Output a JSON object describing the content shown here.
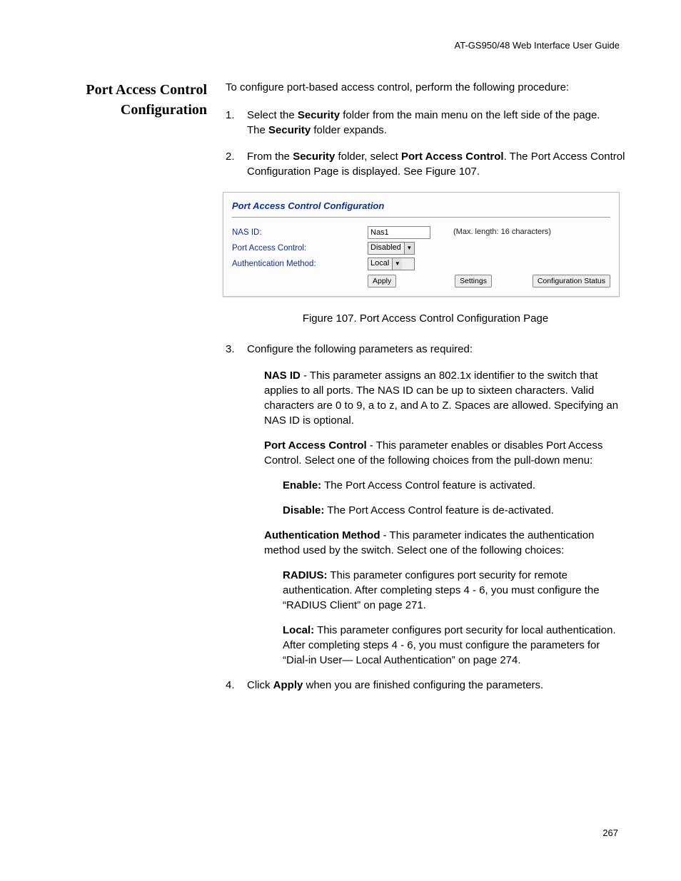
{
  "header": "AT-GS950/48  Web Interface User Guide",
  "page_number": "267",
  "sidebar_title": "Port Access Control Configuration",
  "intro": "To configure port-based access control, perform the following procedure:",
  "step1": {
    "num": "1.",
    "a": "Select the ",
    "bold": "Security",
    "b": " folder from the main menu on the left side of the page.",
    "c_pre": "The ",
    "c_post": " folder expands."
  },
  "step2": {
    "num": "2.",
    "a": "From the ",
    "b_bold": "Security",
    "c": " folder, select ",
    "d_bold": "Port Access Control",
    "e": ". The Port Access Control Configuration Page is displayed. See Figure 107."
  },
  "figure": {
    "panel_title": "Port Access Control Configuration",
    "nas_id_label": "NAS ID:",
    "nas_id_value": "Nas1",
    "nas_id_hint": "(Max. length: 16 characters)",
    "pac_label": "Port Access Control:",
    "pac_value": "Disabled",
    "auth_label": "Authentication Method:",
    "auth_value": "Local",
    "apply_btn": "Apply",
    "settings_btn": "Settings",
    "config_status_btn": "Configuration Status"
  },
  "figure_caption": "Figure 107. Port Access Control Configuration Page",
  "step3": {
    "num": "3.",
    "text": "Configure the following parameters as required:"
  },
  "nas_desc": {
    "bold": "NAS ID",
    "text": " - This parameter assigns an 802.1x identifier to the switch that applies to all ports. The NAS ID can be up to sixteen characters. Valid characters are 0 to 9, a to z, and A to Z. Spaces are allowed. Specifying an NAS ID is optional."
  },
  "pac_desc": {
    "bold": "Port Access Control",
    "text": " - This parameter enables or disables Port Access Control. Select one of the following choices from the pull-down menu:"
  },
  "enable_line": {
    "bold": "Enable:",
    "text": " The Port Access Control feature is activated."
  },
  "disable_line": {
    "bold": "Disable:",
    "text": " The Port Access Control feature is de-activated."
  },
  "auth_desc": {
    "bold": "Authentication Method",
    "text": " - This parameter indicates the authentication method used by the switch. Select one of the following choices:"
  },
  "radius_line": {
    "bold": "RADIUS:",
    "text": " This parameter configures port security for remote authentication. After completing steps 4 - 6, you must configure the “RADIUS Client” on page 271."
  },
  "local_line": {
    "bold": "Local:",
    "text": " This parameter configures port security for local authentication. After completing steps 4 - 6, you must configure the parameters for “Dial-in User— Local Authentication” on page 274."
  },
  "step4": {
    "num": "4.",
    "a": "Click ",
    "bold": "Apply",
    "b": " when you are finished configuring the parameters."
  }
}
